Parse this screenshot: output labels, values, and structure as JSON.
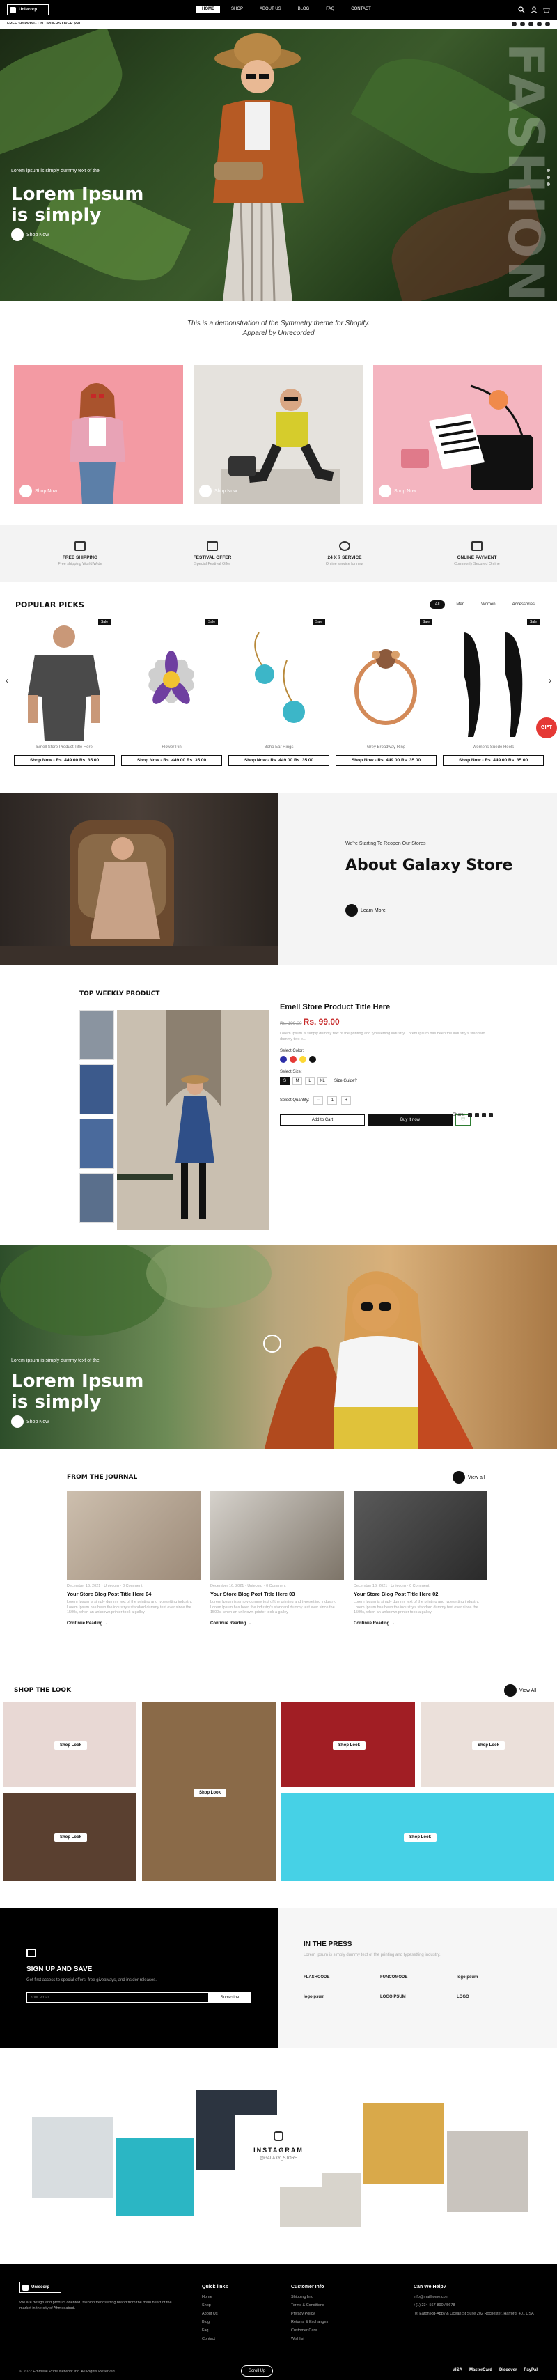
{
  "header": {
    "logo_text": "Uniecorp",
    "nav": [
      "HOME",
      "SHOP",
      "ABOUT US",
      "BLOG",
      "FAQ",
      "CONTACT"
    ],
    "free_shipping": "FREE SHIPPING ON ORDERS OVER $50"
  },
  "hero1": {
    "small": "Lorem ipsum is simply dummy text of the",
    "title": "Lorem Ipsum is simply",
    "button": "Shop Now",
    "bg_word": "FASHION"
  },
  "demo": {
    "line1": "This is a demonstration of the Symmetry theme for Shopify.",
    "line2": "Apparel by Unrecorded"
  },
  "cards": [
    {
      "label": "Shop Now"
    },
    {
      "label": "Shop Now"
    },
    {
      "label": "Shop Now"
    }
  ],
  "features": [
    {
      "title": "FREE SHIPPING",
      "sub": "Free shipping World Wide"
    },
    {
      "title": "FESTIVAL OFFER",
      "sub": "Special Festival Offer"
    },
    {
      "title": "24 X 7 SERVICE",
      "sub": "Online service for new"
    },
    {
      "title": "ONLINE PAYMENT",
      "sub": "Commonly Secured Online"
    }
  ],
  "popular": {
    "title": "POPULAR PICKS",
    "tabs": [
      "All",
      "Men",
      "Women",
      "Accessories"
    ],
    "products": [
      {
        "name": "Emell Store Product Title Here",
        "price": "Shop Now - Rs. 449.00  Rs. 35.00",
        "sale": "Sale"
      },
      {
        "name": "Flower Pin",
        "price": "Shop Now - Rs. 449.00  Rs. 35.00",
        "sale": "Sale"
      },
      {
        "name": "Boho Ear Rings",
        "price": "Shop Now - Rs. 449.00  Rs. 35.00",
        "sale": "Sale"
      },
      {
        "name": "Grey Broadway Ring",
        "price": "Shop Now - Rs. 449.00  Rs. 35.00",
        "sale": "Sale"
      },
      {
        "name": "Womens Suede Heels",
        "price": "Shop Now - Rs. 449.00  Rs. 35.00",
        "sale": "Sale"
      }
    ],
    "gift": "GIFT"
  },
  "about": {
    "small": "We're Starting To Reopen Our Stores",
    "title": "About Galaxy Store",
    "button": "Learn More"
  },
  "weekly": {
    "section_title": "TOP WEEKLY PRODUCT",
    "title": "Emell Store Product Title Here",
    "old_price": "Rs. 199.00",
    "new_price": "Rs. 99.00",
    "desc": "Lorem Ipsum is simply dummy text of the printing and typesetting industry. Lorem Ipsum has been the industry's standard dummy text e...",
    "color_label": "Select Color:",
    "colors": [
      "#2c2fa8",
      "#e53935",
      "#fdd835",
      "#111111"
    ],
    "size_label": "Select Size:",
    "sizes": [
      "S",
      "M",
      "L",
      "XL"
    ],
    "size_guide": "Size Guide?",
    "qty_label": "Select Quantity:",
    "qty": "1",
    "share": "Share:",
    "add": "Add to Cart",
    "buy": "Buy It now"
  },
  "hero2": {
    "small": "Lorem ipsum is simply dummy text of the",
    "title": "Lorem Ipsum is simply",
    "button": "Shop Now"
  },
  "journal": {
    "title": "FROM THE JOURNAL",
    "view_all": "View all",
    "posts": [
      {
        "meta": "December 16, 2021 · Uniecorp · 0 Comment",
        "title": "Your Store Blog Post Title Here 04",
        "desc": "Lorem Ipsum is simply dummy text of the printing and typesetting industry. Lorem Ipsum has been the industry's standard dummy text ever since the 1500s, when an unknown printer took a galley",
        "cta": "Continue Reading →"
      },
      {
        "meta": "December 16, 2021 · Uniecorp · 0 Comment",
        "title": "Your Store Blog Post Title Here 03",
        "desc": "Lorem Ipsum is simply dummy text of the printing and typesetting industry. Lorem Ipsum has been the industry's standard dummy text ever since the 1500s, when an unknown printer took a galley",
        "cta": "Continue Reading →"
      },
      {
        "meta": "December 16, 2021 · Uniecorp · 0 Comment",
        "title": "Your Store Blog Post Title Here 02",
        "desc": "Lorem Ipsum is simply dummy text of the printing and typesetting industry. Lorem Ipsum has been the industry's standard dummy text ever since the 1500s, when an unknown printer took a galley",
        "cta": "Continue Reading →"
      }
    ]
  },
  "look": {
    "title": "SHOP THE LOOK",
    "view_all": "View All",
    "label": "Shop Look"
  },
  "signup": {
    "title": "SIGN UP AND SAVE",
    "desc": "Get first access to special offers, free giveaways, and insider releases.",
    "placeholder": "Your email",
    "button": "Subscribe"
  },
  "press": {
    "title": "IN THE PRESS",
    "desc": "Lorem Ipsum is simply dummy text of the printing and typesetting industry.",
    "brands": [
      "FLASHCODE",
      "FUNCOMODE",
      "logoipsum",
      "logoipsum",
      "LOGOIPSUM",
      "LOGO"
    ]
  },
  "insta": {
    "title": "INSTAGRAM",
    "handle": "@GALAXY_STORE"
  },
  "footer": {
    "logo_text": "Uniecorp",
    "about": "We are design and product oriented, fashion trendsetting brand from the main heart of the market in the city of Ahmedabad.",
    "quick_title": "Quick links",
    "quick": [
      "Home",
      "Shop",
      "About Us",
      "Blog",
      "Faq",
      "Contact"
    ],
    "info_title": "Customer Info",
    "info": [
      "Shipping Info",
      "Terms & Conditions",
      "Privacy Policy",
      "Returns & Exchanges",
      "Customer Care",
      "Wishlist"
    ],
    "help_title": "Can We Help?",
    "help": [
      "info@mailhome.com",
      "+(1) 234-567-890 / 5678",
      "(0) Eaton Rd-Abby & Ocean St Suite 202 Rochester, Harford, 401 USA"
    ],
    "copyright": "© 2022 Emmelie Pride Network Inc. All Rights Reserved.",
    "scroll_up": "Scroll Up",
    "payments": [
      "VISA",
      "MasterCard",
      "Discover",
      "PayPal"
    ]
  }
}
